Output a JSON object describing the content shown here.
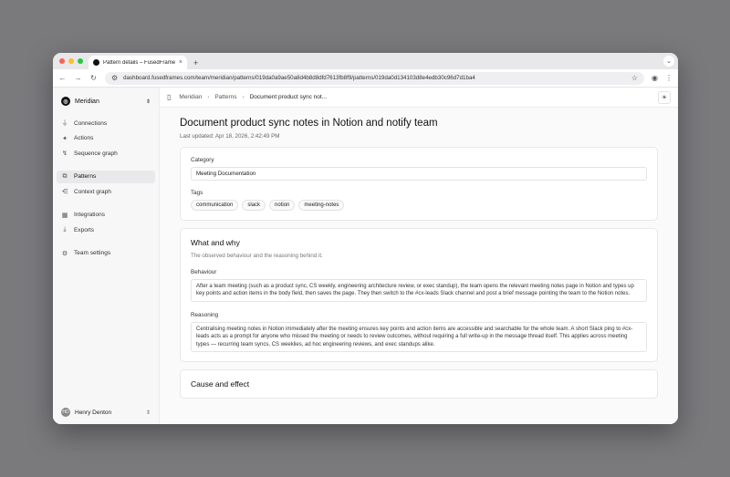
{
  "browser": {
    "tab_title": "Pattern details – FusedFrames",
    "new_tab": "+",
    "url": "dashboard.fusedframes.com/team/meridian/patterns/019da0a9ae50a8d4b8d8dfd7613fb8f9/patterns/019da0d134103d8e4edb30c96d7d1ba4",
    "colors": {
      "red": "#ff5f57",
      "yellow": "#febc2e",
      "green": "#28c840"
    }
  },
  "sidebar": {
    "workspace": "Meridian",
    "groups": [
      [
        {
          "label": "Connections",
          "icon": "plug-icon"
        },
        {
          "label": "Actions",
          "icon": "sparkle-icon"
        },
        {
          "label": "Sequence graph",
          "icon": "route-icon"
        }
      ],
      [
        {
          "label": "Patterns",
          "icon": "workflow-icon",
          "active": true
        },
        {
          "label": "Context graph",
          "icon": "share-icon"
        }
      ],
      [
        {
          "label": "Integrations",
          "icon": "blocks-icon"
        },
        {
          "label": "Exports",
          "icon": "download-icon"
        }
      ],
      [
        {
          "label": "Team settings",
          "icon": "gear-icon"
        }
      ]
    ],
    "user": {
      "name": "Henry Denton"
    }
  },
  "breadcrumb": [
    "Meridian",
    "Patterns",
    "Document product sync not..."
  ],
  "page": {
    "title": "Document product sync notes in Notion and notify team",
    "updated": "Last updated: Apr 18, 2026, 2:42:49 PM",
    "category_label": "Category",
    "category_value": "Meeting Documentation",
    "tags_label": "Tags",
    "tags": [
      "communication",
      "slack",
      "notion",
      "meeting-notes"
    ],
    "what_why": {
      "title": "What and why",
      "subtitle": "The observed behaviour and the reasoning behind it.",
      "behaviour_label": "Behaviour",
      "behaviour": "After a team meeting (such as a product sync, CS weekly, engineering architecture review, or exec standup), the team opens the relevant meeting notes page in Notion and types up key points and action items in the body field, then saves the page. They then switch to the #cx-leads Slack channel and post a brief message pointing the team to the Notion notes.",
      "reasoning_label": "Reasoning",
      "reasoning": "Centralising meeting notes in Notion immediately after the meeting ensures key points and action items are accessible and searchable for the whole team. A short Slack ping to #cx-leads acts as a prompt for anyone who missed the meeting or needs to review outcomes, without requiring a full write-up in the message thread itself. This applies across meeting types — recurring team syncs, CS weeklies, ad hoc engineering reviews, and exec standups alike."
    },
    "cause_effect": {
      "title": "Cause and effect"
    }
  }
}
